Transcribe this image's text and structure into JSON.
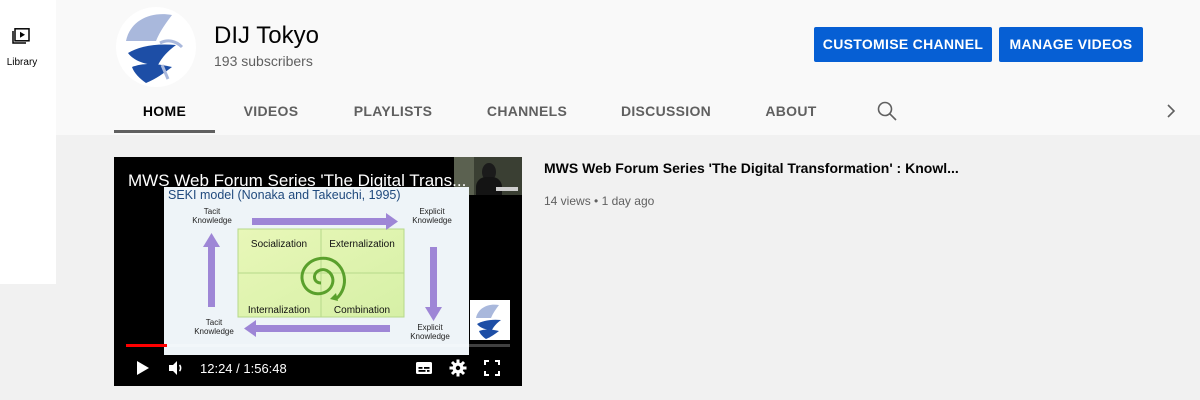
{
  "guide": {
    "library_label": "Library"
  },
  "channel": {
    "name": "DIJ Tokyo",
    "subscribers": "193 subscribers",
    "avatar_icon": "dij-logo-icon"
  },
  "actions": {
    "customise": "CUSTOMISE CHANNEL",
    "manage": "MANAGE VIDEOS"
  },
  "tabs": [
    {
      "label": "HOME",
      "active": true
    },
    {
      "label": "VIDEOS",
      "active": false
    },
    {
      "label": "PLAYLISTS",
      "active": false
    },
    {
      "label": "CHANNELS",
      "active": false
    },
    {
      "label": "DISCUSSION",
      "active": false
    },
    {
      "label": "ABOUT",
      "active": false
    }
  ],
  "featured": {
    "player_title": "MWS Web Forum Series 'The Digital Trans...",
    "title": "MWS Web Forum Series 'The Digital Transformation' : Knowl...",
    "views": "14 views",
    "separator": "•",
    "age": "1 day ago",
    "time": "12:24 / 1:56:48",
    "progress": 0.106,
    "slide": {
      "heading": "SEKI model (Nonaka and Takeuchi, 1995)",
      "tl_label": [
        "Tacit",
        "Knowledge"
      ],
      "tr_label": [
        "Explicit",
        "Knowledge"
      ],
      "bl_label": [
        "Tacit",
        "Knowledge"
      ],
      "br_label": [
        "Explicit",
        "Knowledge"
      ],
      "q_socialization": "Socialization",
      "q_externalization": "Externalization",
      "q_internalization": "Internalization",
      "q_combination": "Combination"
    }
  },
  "colors": {
    "accent": "#065fd4",
    "progress": "#ff0000",
    "avatar_light": "#a9b8dc",
    "avatar_dark": "#1d4ea6"
  }
}
